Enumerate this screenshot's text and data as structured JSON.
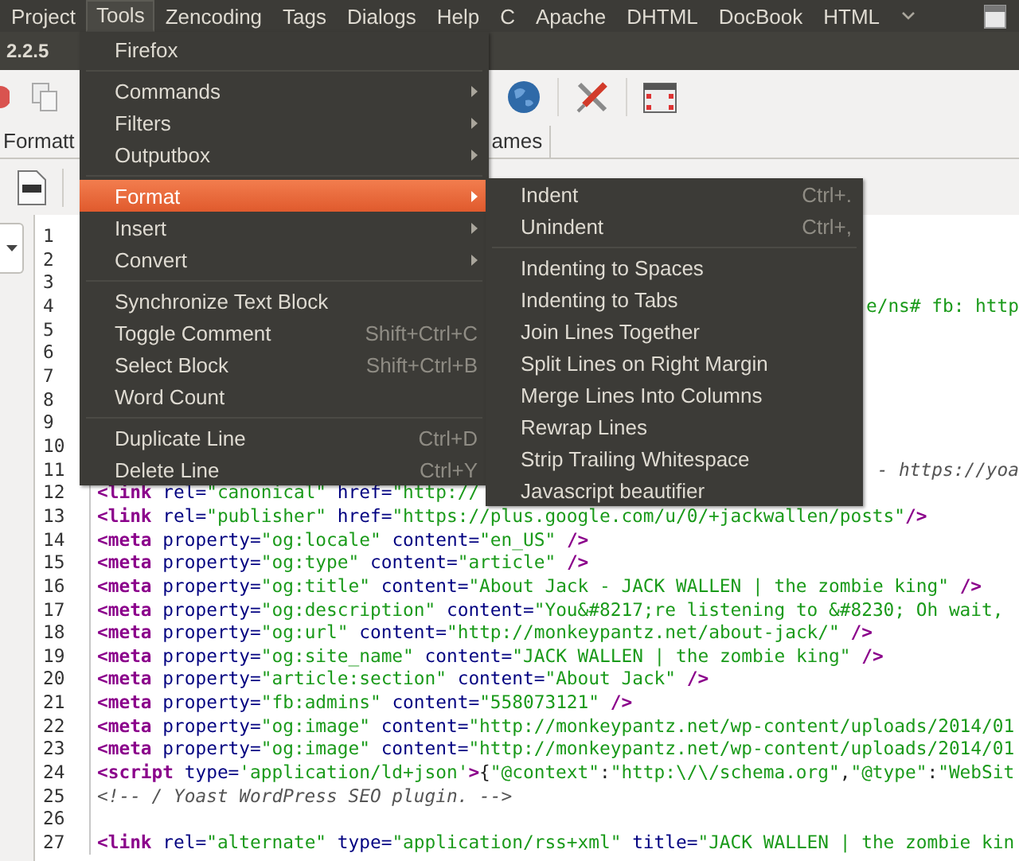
{
  "menubar": {
    "items": [
      {
        "label": "Project",
        "selected": false
      },
      {
        "label": "Tools",
        "selected": true
      },
      {
        "label": "Zencoding",
        "selected": false
      },
      {
        "label": "Tags",
        "selected": false
      },
      {
        "label": "Dialogs",
        "selected": false
      },
      {
        "label": "Help",
        "selected": false
      },
      {
        "label": "C",
        "selected": false
      },
      {
        "label": "Apache",
        "selected": false
      },
      {
        "label": "DHTML",
        "selected": false
      },
      {
        "label": "DocBook",
        "selected": false
      },
      {
        "label": "HTML",
        "selected": false
      }
    ]
  },
  "version": "2.2.5",
  "tabs": [
    {
      "label": "Formatt"
    },
    {
      "label": "ames"
    }
  ],
  "tools_menu": {
    "items": [
      {
        "kind": "item",
        "label": "Firefox",
        "selected": false
      },
      {
        "kind": "separator"
      },
      {
        "kind": "submenu",
        "label": "Commands",
        "selected": false
      },
      {
        "kind": "submenu",
        "label": "Filters",
        "selected": false
      },
      {
        "kind": "submenu",
        "label": "Outputbox",
        "selected": false
      },
      {
        "kind": "separator"
      },
      {
        "kind": "submenu",
        "label": "Format",
        "selected": true
      },
      {
        "kind": "submenu",
        "label": "Insert",
        "selected": false
      },
      {
        "kind": "submenu",
        "label": "Convert",
        "selected": false
      },
      {
        "kind": "separator"
      },
      {
        "kind": "item",
        "label": "Synchronize Text Block",
        "selected": false
      },
      {
        "kind": "item",
        "label": "Toggle Comment",
        "shortcut": "Shift+Ctrl+C",
        "selected": false
      },
      {
        "kind": "item",
        "label": "Select Block",
        "shortcut": "Shift+Ctrl+B",
        "selected": false
      },
      {
        "kind": "item",
        "label": "Word Count",
        "selected": false
      },
      {
        "kind": "separator"
      },
      {
        "kind": "item",
        "label": "Duplicate Line",
        "shortcut": "Ctrl+D",
        "selected": false
      },
      {
        "kind": "item",
        "label": "Delete Line",
        "shortcut": "Ctrl+Y",
        "selected": false
      }
    ]
  },
  "format_submenu": {
    "items": [
      {
        "kind": "item",
        "label": "Indent",
        "shortcut": "Ctrl+.",
        "selected": false
      },
      {
        "kind": "item",
        "label": "Unindent",
        "shortcut": "Ctrl+,",
        "selected": false
      },
      {
        "kind": "separator"
      },
      {
        "kind": "item",
        "label": "Indenting to Spaces",
        "selected": false
      },
      {
        "kind": "item",
        "label": "Indenting to Tabs",
        "selected": false
      },
      {
        "kind": "item",
        "label": "Join Lines Together",
        "selected": false
      },
      {
        "kind": "item",
        "label": "Split Lines on Right Margin",
        "selected": false
      },
      {
        "kind": "item",
        "label": "Merge Lines Into Columns",
        "selected": false
      },
      {
        "kind": "item",
        "label": "Rewrap Lines",
        "selected": false
      },
      {
        "kind": "item",
        "label": "Strip Trailing Whitespace",
        "selected": false
      },
      {
        "kind": "item",
        "label": "Javascript beautifier",
        "selected": false
      }
    ]
  },
  "editor": {
    "lines": [
      {
        "number": "1",
        "kind": "empty"
      },
      {
        "number": "2",
        "kind": "empty"
      },
      {
        "number": "3",
        "kind": "empty"
      },
      {
        "number": "4",
        "kind": "string-tail",
        "code": "e/ns# fb: http"
      },
      {
        "number": "5",
        "kind": "empty"
      },
      {
        "number": "6",
        "kind": "empty"
      },
      {
        "number": "7",
        "kind": "empty"
      },
      {
        "number": "8",
        "kind": "empty"
      },
      {
        "number": "9",
        "kind": "empty"
      },
      {
        "number": "10",
        "kind": "empty"
      },
      {
        "number": "11",
        "kind": "comment-tail",
        "code": "- https://yoa"
      },
      {
        "number": "12",
        "kind": "code",
        "code": "<link rel=\"canonical\" href=\"http://"
      },
      {
        "number": "13",
        "kind": "code",
        "code": "<link rel=\"publisher\" href=\"https://plus.google.com/u/0/+jackwallen/posts\"/>"
      },
      {
        "number": "14",
        "kind": "code",
        "code": "<meta property=\"og:locale\" content=\"en_US\" />"
      },
      {
        "number": "15",
        "kind": "code",
        "code": "<meta property=\"og:type\" content=\"article\" />"
      },
      {
        "number": "16",
        "kind": "code",
        "code": "<meta property=\"og:title\" content=\"About Jack - JACK WALLEN | the zombie king\" />"
      },
      {
        "number": "17",
        "kind": "code",
        "code": "<meta property=\"og:description\" content=\"You&#8217;re listening to &#8230; Oh wait,"
      },
      {
        "number": "18",
        "kind": "code",
        "code": "<meta property=\"og:url\" content=\"http://monkeypantz.net/about-jack/\" />"
      },
      {
        "number": "19",
        "kind": "code",
        "code": "<meta property=\"og:site_name\" content=\"JACK WALLEN | the zombie king\" />"
      },
      {
        "number": "20",
        "kind": "code",
        "code": "<meta property=\"article:section\" content=\"About Jack\" />"
      },
      {
        "number": "21",
        "kind": "code",
        "code": "<meta property=\"fb:admins\" content=\"558073121\" />"
      },
      {
        "number": "22",
        "kind": "code",
        "code": "<meta property=\"og:image\" content=\"http://monkeypantz.net/wp-content/uploads/2014/01"
      },
      {
        "number": "23",
        "kind": "code",
        "code": "<meta property=\"og:image\" content=\"http://monkeypantz.net/wp-content/uploads/2014/01"
      },
      {
        "number": "24",
        "kind": "code",
        "code": "<script type='application/ld+json'>{\"@context\":\"http:\\/\\/schema.org\",\"@type\":\"WebSit"
      },
      {
        "number": "25",
        "kind": "comment",
        "code": "<!-- / Yoast WordPress SEO plugin. -->"
      },
      {
        "number": "26",
        "kind": "empty"
      },
      {
        "number": "27",
        "kind": "code",
        "code": "<link rel=\"alternate\" type=\"application/rss+xml\" title=\"JACK WALLEN | the zombie kin"
      }
    ]
  }
}
